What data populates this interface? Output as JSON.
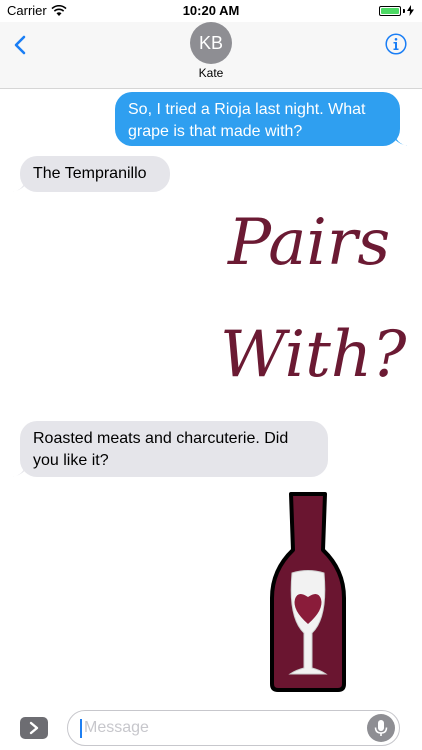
{
  "status_bar": {
    "carrier": "Carrier",
    "time": "10:20 AM",
    "battery_color": "#4cd964"
  },
  "header": {
    "avatar_initials": "KB",
    "contact_name": "Kate",
    "back_icon": "chevron-left-icon",
    "info_icon": "info-icon",
    "accent": "#1a7ef5"
  },
  "messages": [
    {
      "type": "sent",
      "text": "So, I tried a Rioja last night. What grape is that made with?"
    },
    {
      "type": "received",
      "text": "The Tempranillo"
    },
    {
      "type": "sticker",
      "line1": "Pairs",
      "line2": "With?"
    },
    {
      "type": "received",
      "text": "Roasted meats and charcuterie. Did you like it?"
    },
    {
      "type": "sticker-image",
      "icon": "wine-bottle-heart-icon"
    }
  ],
  "composer": {
    "placeholder": "Message",
    "expand_icon": "chevron-right-icon",
    "mic_icon": "microphone-icon"
  },
  "colors": {
    "sent_bubble": "#2f9ff0",
    "received_bubble": "#e5e5ea",
    "sticker_text": "#6b1a33",
    "bottle": "#6a1530"
  }
}
